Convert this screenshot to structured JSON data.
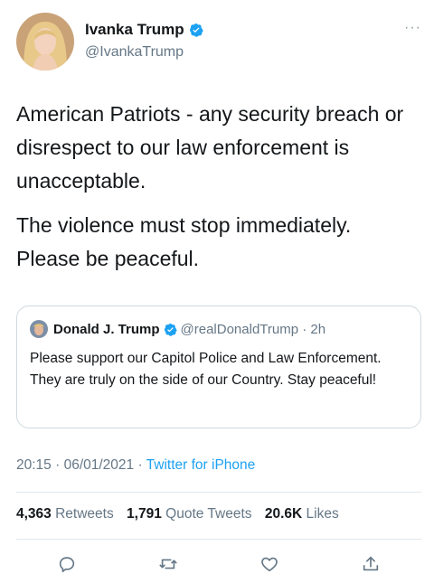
{
  "tweet": {
    "author_name": "Ivanka Trump",
    "author_handle": "@IvankaTrump",
    "paragraphs": [
      "American Patriots - any security breach or disrespect to our law enforcement is unacceptable.",
      "The violence must stop immediately. Please be peaceful."
    ],
    "time": "20:15",
    "date": "06/01/2021",
    "source": "Twitter for iPhone"
  },
  "quote": {
    "author_name": "Donald J. Trump",
    "author_handle": "@realDonaldTrump",
    "age": "2h",
    "text": "Please support our Capitol Police and Law Enforcement. They are truly on the side of our Country. Stay peaceful!"
  },
  "stats": {
    "retweets_count": "4,363",
    "retweets_label": "Retweets",
    "quotes_count": "1,791",
    "quotes_label": "Quote Tweets",
    "likes_count": "20.6K",
    "likes_label": "Likes"
  },
  "icons": {
    "reply": "speech-bubble-icon",
    "retweet": "retweet-icon",
    "like": "heart-icon",
    "share": "share-icon",
    "verified": "verified-badge-icon",
    "more": "ellipsis-icon"
  },
  "colors": {
    "accent": "#1da1f2",
    "muted": "#657786",
    "text": "#14171a"
  }
}
